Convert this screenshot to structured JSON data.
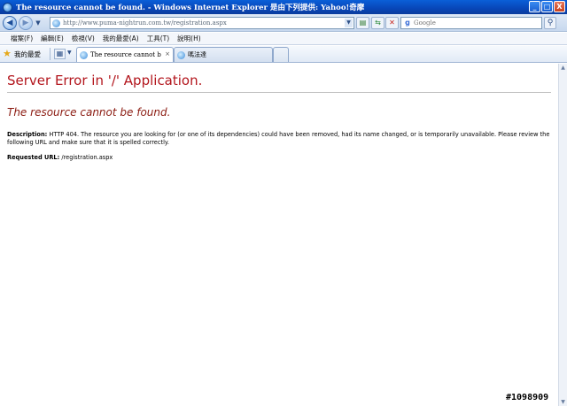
{
  "window": {
    "title": "The resource cannot be found. - Windows Internet Explorer 是由下列提供: Yahoo!奇摩",
    "buttons": {
      "minimize": "_",
      "maximize": "□",
      "close": "X"
    }
  },
  "address_bar": {
    "url": "http://www.puma-nightrun.com.tw/registration.aspx",
    "search_placeholder": "Google"
  },
  "menu": {
    "items": [
      "檔案(F)",
      "編輯(E)",
      "檢視(V)",
      "我的最愛(A)",
      "工具(T)",
      "說明(H)"
    ]
  },
  "favorites_bar": {
    "favorites_label": "我的最愛",
    "tabs": [
      {
        "label": "The resource cannot be fo...",
        "close": "×"
      },
      {
        "label": "嗎法達"
      }
    ]
  },
  "page": {
    "title": "Server Error in '/' Application.",
    "subtitle": "The resource cannot be found.",
    "description_label": "Description:",
    "description_text": "HTTP 404. The resource you are looking for (or one of its dependencies) could have been removed, had its name changed, or is temporarily unavailable.  Please review the following URL and make sure that it is spelled correctly.",
    "requested_url_label": "Requested URL:",
    "requested_url": "/registration.aspx"
  },
  "watermark": "#1098909",
  "colors": {
    "error_title": "#b3161d",
    "error_subtitle": "#8b1a10",
    "title_bar": "#0846b8"
  }
}
